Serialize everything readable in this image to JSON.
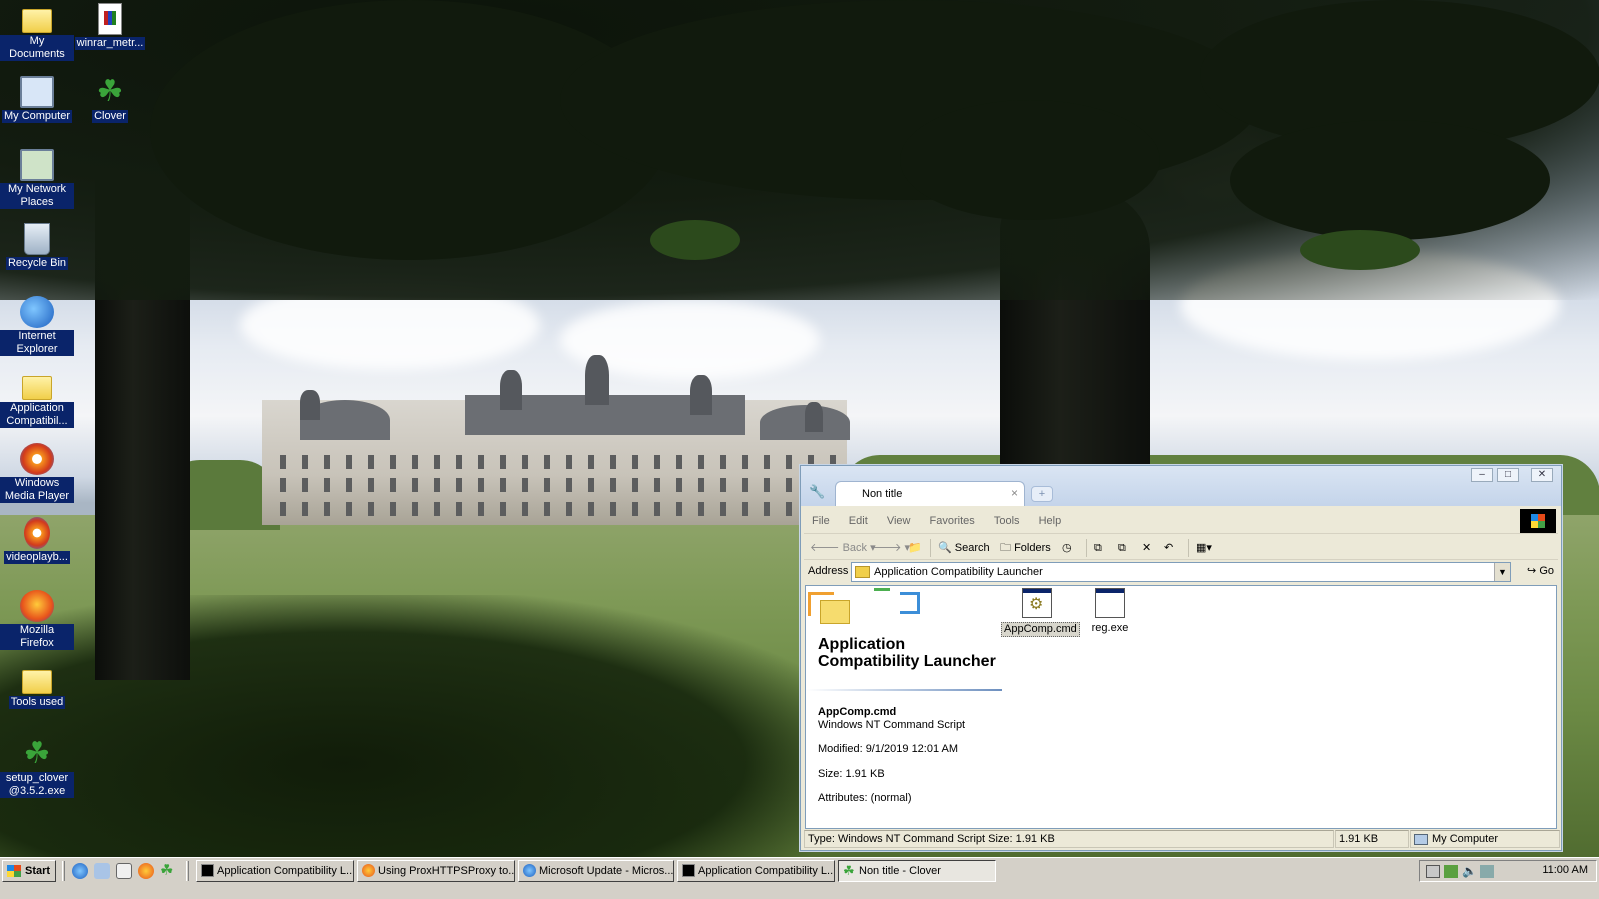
{
  "desktop": {
    "icons": [
      {
        "label": "My Documents",
        "icon": "folder-documents-icon"
      },
      {
        "label": "winrar_metr...",
        "icon": "winrar-archive-icon"
      },
      {
        "label": "My Computer",
        "icon": "computer-icon"
      },
      {
        "label": "Clover",
        "icon": "clover-icon"
      },
      {
        "label": "My Network Places",
        "icon": "network-icon"
      },
      {
        "label": "Recycle Bin",
        "icon": "recycle-bin-icon"
      },
      {
        "label": "Internet Explorer",
        "icon": "internet-explorer-icon"
      },
      {
        "label": "Application Compatibil...",
        "icon": "folder-icon"
      },
      {
        "label": "Windows Media Player",
        "icon": "media-player-icon"
      },
      {
        "label": "videoplayb...",
        "icon": "video-file-icon"
      },
      {
        "label": "Mozilla Firefox",
        "icon": "firefox-icon"
      },
      {
        "label": "Tools used",
        "icon": "folder-icon"
      },
      {
        "label": "setup_clover @3.5.2.exe",
        "icon": "clover-setup-icon"
      }
    ]
  },
  "window": {
    "tab_title": "Non title",
    "tab_close": "×",
    "new_tab": "+",
    "controls": {
      "minimize": "–",
      "maximize": "□",
      "close": "✕"
    },
    "menu": [
      "File",
      "Edit",
      "View",
      "Favorites",
      "Tools",
      "Help"
    ],
    "toolbar": {
      "back": "Back",
      "search": "Search",
      "folders": "Folders"
    },
    "address": {
      "label": "Address",
      "value": "Application Compatibility Launcher",
      "go": "Go"
    },
    "info_pane": {
      "title": "Application Compatibility Launcher",
      "selected_name": "AppComp.cmd",
      "selected_type": "Windows NT Command Script",
      "modified": "Modified: 9/1/2019 12:01 AM",
      "size": "Size: 1.91 KB",
      "attributes": "Attributes: (normal)"
    },
    "files": [
      {
        "name": "AppComp.cmd",
        "selected": true
      },
      {
        "name": "reg.exe",
        "selected": false
      }
    ],
    "status": {
      "description": "Type: Windows NT Command Script Size: 1.91 KB",
      "size": "1.91 KB",
      "zone": "My Computer"
    }
  },
  "taskbar": {
    "start": "Start",
    "tasks": [
      {
        "label": "Application Compatibility L...",
        "icon": "cmd-icon"
      },
      {
        "label": "Using ProxHTTPSProxy to...",
        "icon": "firefox-icon"
      },
      {
        "label": "Microsoft Update - Micros...",
        "icon": "internet-explorer-icon"
      },
      {
        "label": "Application Compatibility L...",
        "icon": "cmd-icon"
      },
      {
        "label": "Non title - Clover",
        "icon": "clover-icon"
      }
    ],
    "clock": "11:00 AM"
  }
}
